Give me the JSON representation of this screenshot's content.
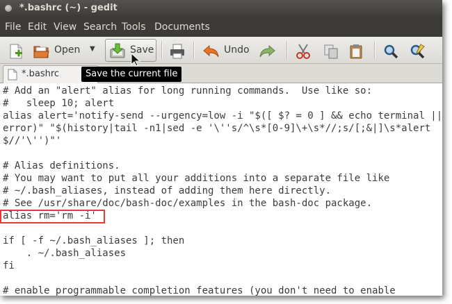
{
  "window": {
    "title": "*.bashrc (~) - gedit"
  },
  "menu": [
    "File",
    "Edit",
    "View",
    "Search",
    "Tools",
    "Documents"
  ],
  "toolbar": {
    "open_label": "Open",
    "save_label": "Save",
    "undo_label": "Undo"
  },
  "tab": {
    "label": "*.bashrc",
    "close": "×"
  },
  "tooltip": "Save the current file",
  "editor": {
    "lines": [
      "# Add an \"alert\" alias for long running commands.  Use like so:",
      "#   sleep 10; alert",
      "alias alert='notify-send --urgency=low -i \"$([ $? = 0 ] && echo terminal ||",
      "error)\" \"$(history|tail -n1|sed -e '\\''s/^\\s*[0-9]\\+\\s*//;s/[;&|]\\s*alert",
      "$//'\\'')\"'",
      "",
      "# Alias definitions.",
      "# You may want to put all your additions into a separate file like",
      "# ~/.bash_aliases, instead of adding them here directly.",
      "# See /usr/share/doc/bash-doc/examples in the bash-doc package.",
      "alias rm='rm -i'",
      "",
      "if [ -f ~/.bash_aliases ]; then",
      "    . ~/.bash_aliases",
      "fi",
      "",
      "# enable programmable completion features (you don't need to enable"
    ]
  },
  "colors": {
    "highlight_box": "#e23a3a",
    "title_bar": "#3c3b37",
    "tooltip_bg": "#000000"
  }
}
